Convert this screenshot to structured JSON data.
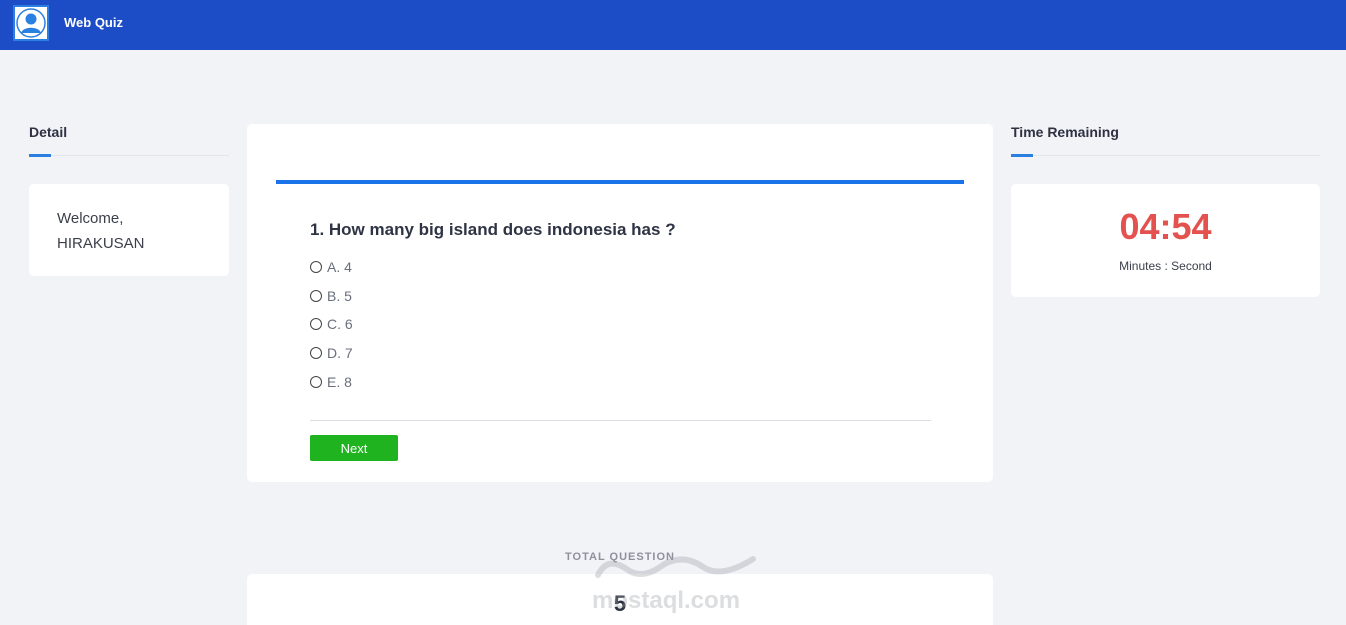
{
  "navbar": {
    "brand": "Web Quiz",
    "avatar_icon": "user-avatar-icon"
  },
  "detail": {
    "title": "Detail",
    "welcome_line1": "Welcome,",
    "welcome_line2": "HIRAKUSAN"
  },
  "quiz": {
    "question": "1. How many big island does indonesia has ?",
    "options": [
      "A. 4",
      "B. 5",
      "C. 6",
      "D. 7",
      "E. 8"
    ],
    "next_label": "Next"
  },
  "timer": {
    "title": "Time Remaining",
    "value": "04:54",
    "label": "Minutes : Second"
  },
  "total": {
    "label": "TOTAL QUESTION",
    "value": "5"
  },
  "watermark": {
    "text": "mostaql.com"
  },
  "colors": {
    "navbar": "#1c4dc6",
    "accent": "#1a73e8",
    "timer": "#e3524f",
    "next": "#1fb31f"
  }
}
